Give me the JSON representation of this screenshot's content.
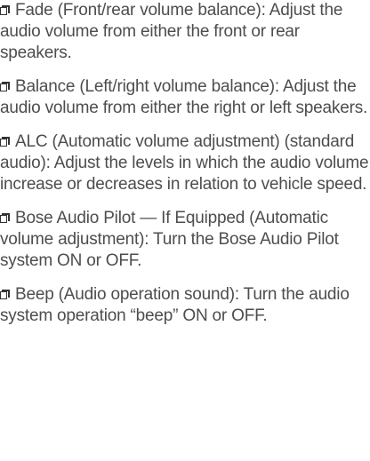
{
  "items": [
    {
      "bullet_icon": "checkbox-bullet-icon",
      "text": "Fade (Front/rear volume balance): Adjust the audio volume from either the front or rear speakers."
    },
    {
      "bullet_icon": "checkbox-bullet-icon",
      "text": "Balance (Left/right volume balance): Adjust the audio volume from either the right or left speakers."
    },
    {
      "bullet_icon": "checkbox-bullet-icon",
      "text": "ALC (Automatic volume adjustment) (standard audio): Adjust the levels in which the audio volume increase or decreases in relation to vehicle speed."
    },
    {
      "bullet_icon": "checkbox-bullet-icon",
      "text": "Bose Audio Pilot — If Equipped (Automatic volume adjustment): Turn the Bose Audio Pilot system ON or OFF."
    },
    {
      "bullet_icon": "checkbox-bullet-icon",
      "text": "Beep (Audio operation sound): Turn the audio system operation “beep” ON or OFF."
    }
  ]
}
